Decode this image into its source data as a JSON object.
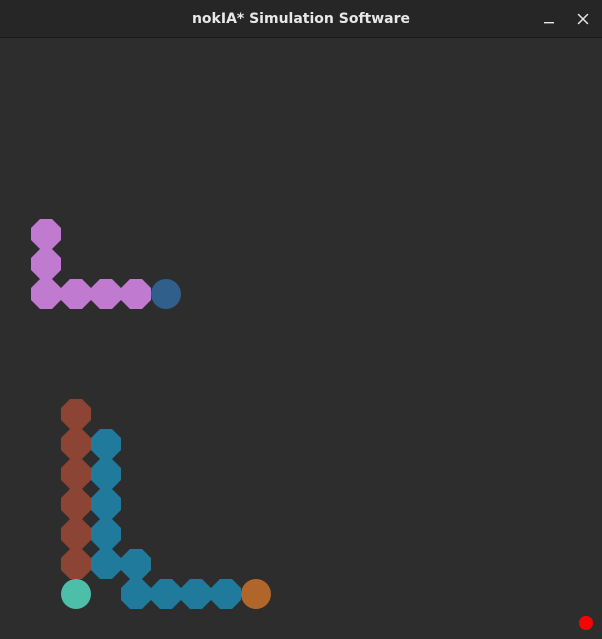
{
  "window": {
    "title": "nokIA* Simulation Software",
    "controls": [
      {
        "name": "minimize-button",
        "icon": "minimize-icon"
      },
      {
        "name": "close-button",
        "icon": "close-icon"
      }
    ]
  },
  "game": {
    "background": "#2d2d2d",
    "snakes": [
      {
        "id": "purple",
        "body_color": "#c07bd0",
        "head_color": "#2f5f8a",
        "body": [
          [
            1,
            6
          ],
          [
            1,
            7
          ],
          [
            1,
            8
          ],
          [
            2,
            8
          ],
          [
            3,
            8
          ],
          [
            4,
            8
          ]
        ],
        "head": [
          5,
          8
        ]
      },
      {
        "id": "brown",
        "body_color": "#8c4535",
        "head_color": "#4dbfa8",
        "body": [
          [
            2,
            12
          ],
          [
            2,
            13
          ],
          [
            2,
            14
          ],
          [
            2,
            15
          ],
          [
            2,
            16
          ],
          [
            2,
            17
          ]
        ],
        "head": [
          2,
          18
        ]
      },
      {
        "id": "teal",
        "body_color": "#1f7a9b",
        "head_color": "#b0662a",
        "body": [
          [
            3,
            13
          ],
          [
            3,
            14
          ],
          [
            3,
            15
          ],
          [
            3,
            16
          ],
          [
            3,
            17
          ],
          [
            4,
            17
          ],
          [
            4,
            18
          ],
          [
            5,
            18
          ],
          [
            6,
            18
          ],
          [
            7,
            18
          ]
        ],
        "head": [
          8,
          18
        ]
      }
    ],
    "food": {
      "color": "#ff0000"
    }
  }
}
